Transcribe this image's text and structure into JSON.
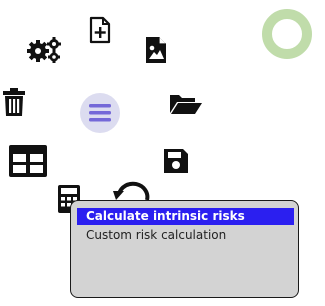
{
  "toolbar": {
    "icons": [
      "settings-gears-icon",
      "file-add-icon",
      "file-image-icon",
      "ring-indicator-icon",
      "trash-icon",
      "hamburger-menu-icon",
      "folder-open-icon",
      "table-icon",
      "save-icon",
      "calculator-icon",
      "undo-icon"
    ]
  },
  "colors": {
    "accent": "#2b1ff0",
    "menu_button_bg": "#dcdcf0",
    "menu_lines": "#7468d8",
    "ring": "#c0dcaa",
    "popup_bg": "#d3d3d3"
  },
  "context_menu": {
    "items": [
      {
        "label": "Calculate intrinsic risks",
        "selected": true
      },
      {
        "label": "Custom risk calculation",
        "selected": false
      }
    ]
  }
}
